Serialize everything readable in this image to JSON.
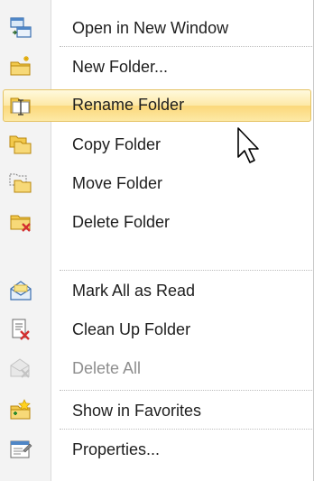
{
  "menu": {
    "items": [
      {
        "label": "Open in New Window",
        "icon": "open-window-icon",
        "state": "normal"
      },
      {
        "label": "New Folder...",
        "icon": "new-folder-icon",
        "state": "normal"
      },
      {
        "label": "Rename Folder",
        "icon": "rename-folder-icon",
        "state": "highlighted"
      },
      {
        "label": "Copy Folder",
        "icon": "copy-folder-icon",
        "state": "normal"
      },
      {
        "label": "Move Folder",
        "icon": "move-folder-icon",
        "state": "normal"
      },
      {
        "label": "Delete Folder",
        "icon": "delete-folder-icon",
        "state": "normal"
      },
      {
        "label": "Mark All as Read",
        "icon": "mark-read-icon",
        "state": "normal"
      },
      {
        "label": "Clean Up Folder",
        "icon": "clean-up-icon",
        "state": "normal"
      },
      {
        "label": "Delete All",
        "icon": "delete-all-icon",
        "state": "disabled"
      },
      {
        "label": "Show in Favorites",
        "icon": "favorites-icon",
        "state": "normal"
      },
      {
        "label": "Properties...",
        "icon": "properties-icon",
        "state": "normal"
      }
    ]
  },
  "colors": {
    "highlight_border": "#e5c365",
    "highlight_fill": "#fde9a6",
    "text": "#1e1e1e",
    "disabled_text": "#8e8e8e",
    "gutter": "#f3f3f3"
  }
}
